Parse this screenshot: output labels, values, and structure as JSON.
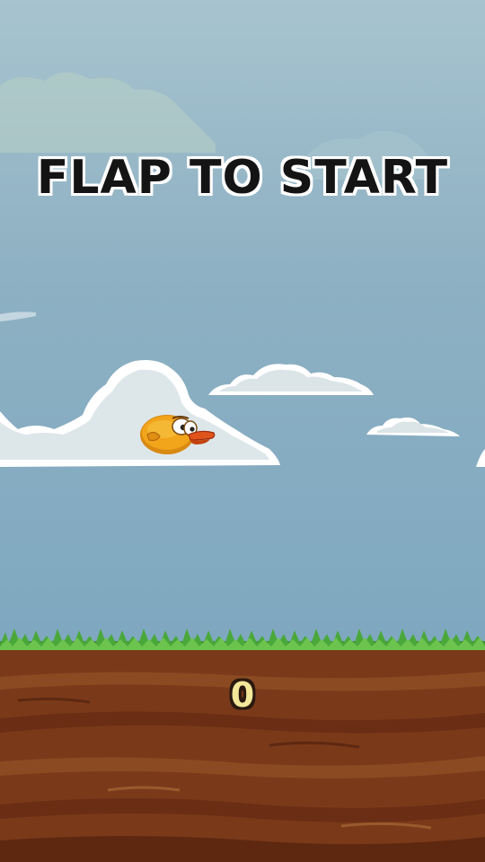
{
  "game": {
    "start_prompt": "FLAP TO START",
    "score": "0"
  },
  "colors": {
    "sky": "#8eb1c3",
    "grass": "#4aa83a",
    "dirt": "#7a3a1a",
    "bird": "#f2a51a",
    "beak": "#e0541c"
  },
  "icons": {
    "player": "bird-sprite",
    "clouds": "cloud-shapes"
  }
}
